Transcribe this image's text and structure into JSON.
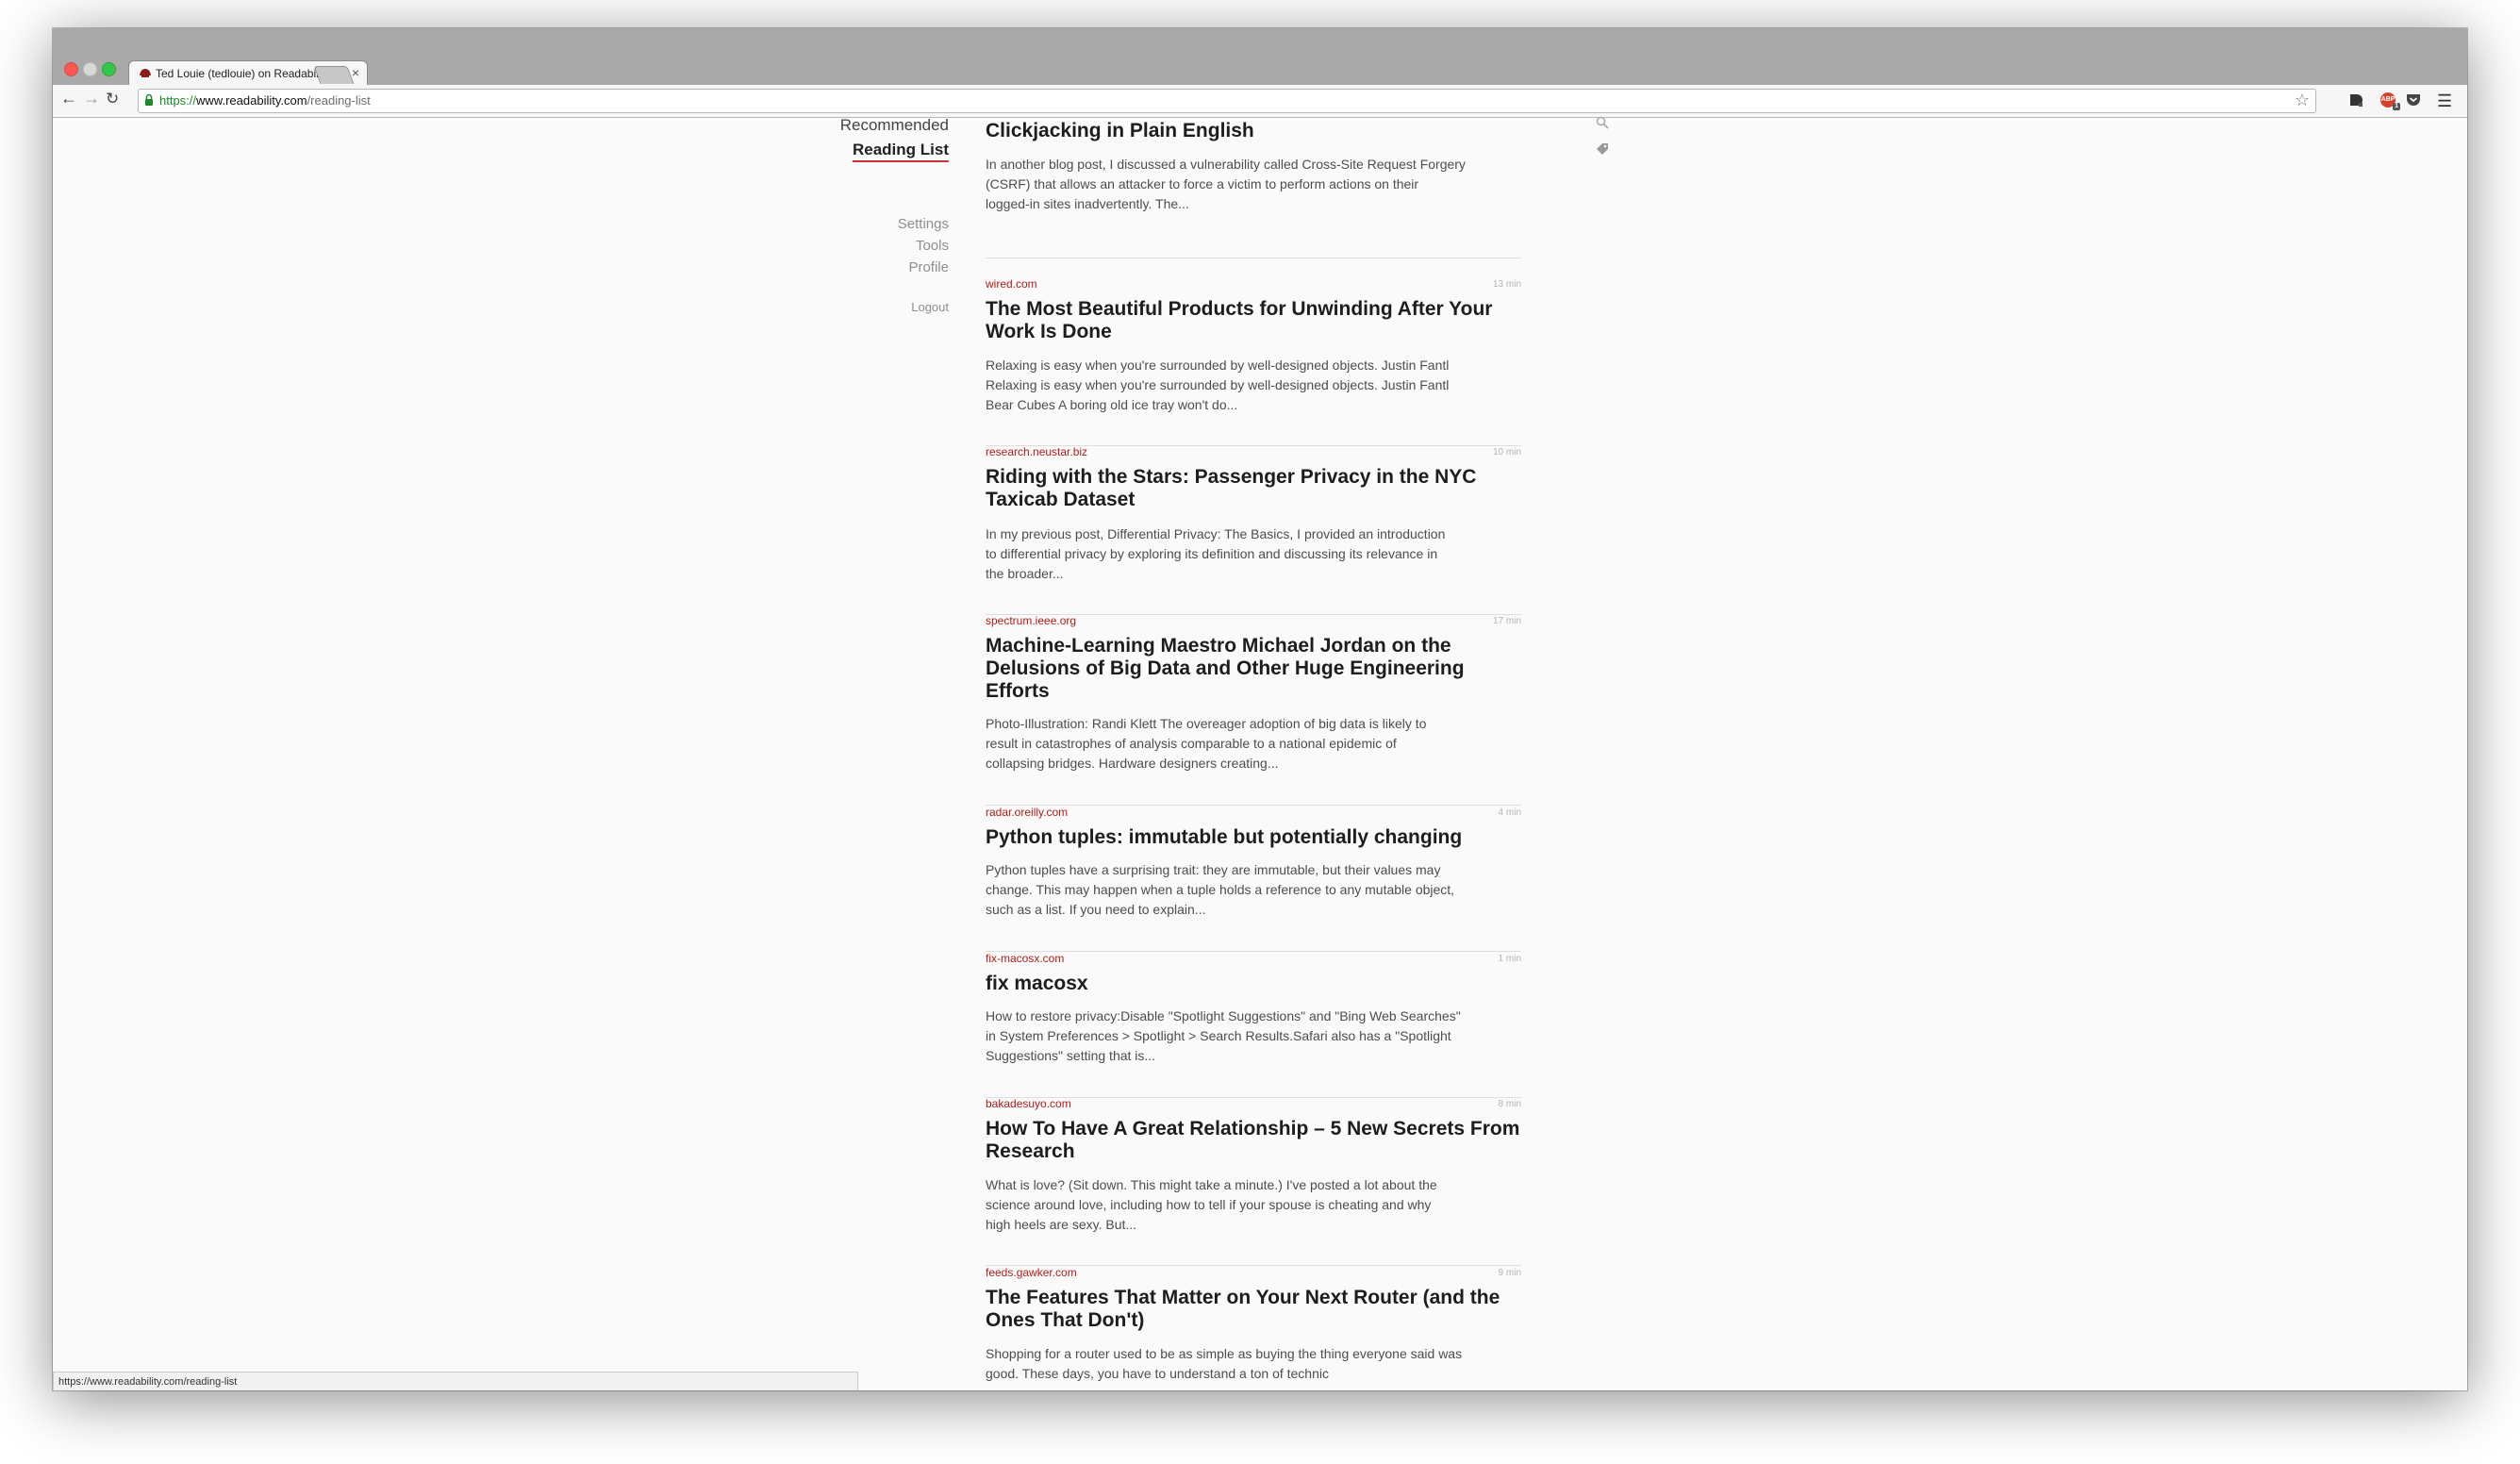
{
  "browser": {
    "tab": {
      "title": "Ted Louie (tedlouie) on Readability"
    },
    "address_bar": {
      "scheme": "https://",
      "host": "www.readability.com",
      "path": "/reading-list"
    },
    "extensions": [
      "readability-extension-icon",
      "adblock-plus-icon",
      "pocket-icon"
    ],
    "adblock_count": "1",
    "status_url": "https://www.readability.com/reading-list"
  },
  "sidebar": {
    "recommended": "Recommended",
    "reading_list": "Reading List",
    "settings": "Settings",
    "tools": "Tools",
    "profile": "Profile",
    "logout": "Logout"
  },
  "right_icons": [
    "search-icon",
    "tag-icon"
  ],
  "articles": [
    {
      "domain": "",
      "time": "",
      "title": "Clickjacking in Plain English",
      "excerpt": "In another blog post, I discussed a vulnerability called Cross-Site Request Forgery\n(CSRF) that allows an attacker to force a victim to perform actions on their\nlogged-in sites inadvertently. The..."
    },
    {
      "domain": "wired.com",
      "time": "13 min",
      "title": "The Most Beautiful Products for Unwinding After Your Work Is Done",
      "excerpt": "Relaxing is easy when you're surrounded by well-designed objects. Justin Fantl\nRelaxing is easy when you're surrounded by well-designed objects. Justin Fantl\nBear Cubes A boring old ice tray won't do..."
    },
    {
      "domain": "research.neustar.biz",
      "time": "10 min",
      "title": "Riding with the Stars: Passenger Privacy in the NYC Taxicab Dataset",
      "excerpt": "In my previous post, Differential Privacy: The Basics, I provided an introduction\nto differential privacy by exploring its definition and discussing its relevance in\nthe broader..."
    },
    {
      "domain": "spectrum.ieee.org",
      "time": "17 min",
      "title": "Machine-Learning Maestro Michael Jordan on the Delusions of Big Data and Other Huge Engineering Efforts",
      "excerpt": "Photo-Illustration: Randi Klett The overeager adoption of big data is likely to\nresult in catastrophes of analysis comparable to a national epidemic of\ncollapsing bridges. Hardware designers creating..."
    },
    {
      "domain": "radar.oreilly.com",
      "time": "4 min",
      "title": "Python tuples: immutable but potentially changing",
      "excerpt": "Python tuples have a surprising trait: they are immutable, but their values may\nchange. This may happen when a tuple holds a reference to any mutable object,\nsuch as a list. If you need to explain..."
    },
    {
      "domain": "fix-macosx.com",
      "time": "1 min",
      "title": "fix macosx",
      "excerpt": "How to restore privacy:Disable \"Spotlight Suggestions\" and \"Bing Web Searches\"\nin System Preferences > Spotlight > Search Results.Safari also has a \"Spotlight\nSuggestions\" setting that is..."
    },
    {
      "domain": "bakadesuyo.com",
      "time": "8 min",
      "title": "How To Have A Great Relationship – 5 New Secrets From Research",
      "excerpt": "What is love? (Sit down. This might take a minute.) I've posted a lot about the\nscience around love, including how to tell if your spouse is cheating and why\nhigh heels are sexy. But..."
    },
    {
      "domain": "feeds.gawker.com",
      "time": "9 min",
      "title": "The Features That Matter on Your Next Router (and the Ones That Don't)",
      "excerpt": "Shopping for a router used to be as simple as buying the thing everyone said was\ngood. These days, you have to understand a ton of technic"
    }
  ]
}
